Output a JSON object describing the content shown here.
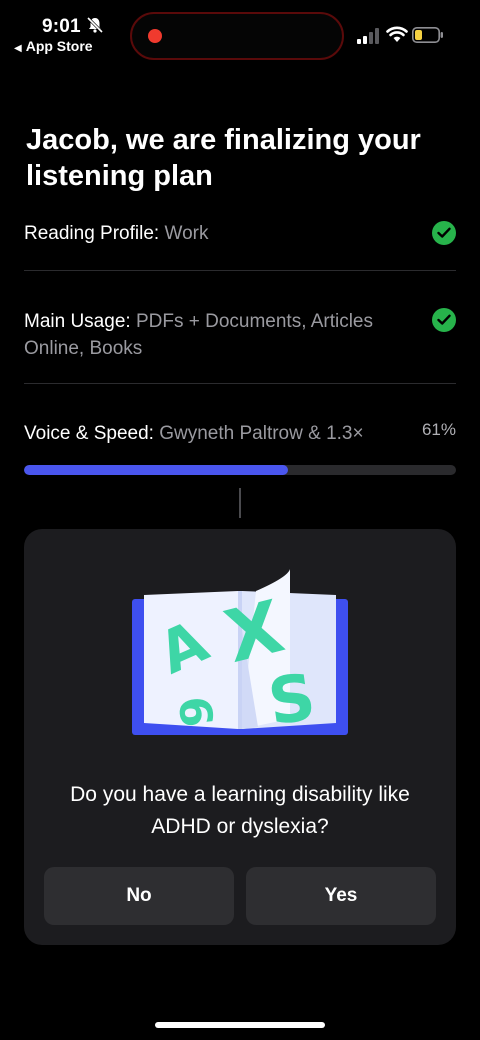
{
  "status_bar": {
    "time": "9:01",
    "back_app": "App Store",
    "icons": [
      "bell-slash-icon",
      "recording-dot-icon",
      "cellular-signal-icon",
      "wifi-icon",
      "battery-low-icon"
    ],
    "colors": {
      "recording": "#f03a2e",
      "battery_level": "#f5d142"
    }
  },
  "title": "Jacob, we are finalizing your listening plan",
  "plan": {
    "items": [
      {
        "label": "Reading Profile:",
        "value": "Work",
        "status": "done"
      },
      {
        "label": "Main Usage:",
        "value": "PDFs + Documents, Articles Online, Books",
        "status": "done"
      },
      {
        "label": "Voice & Speed:",
        "value": "Gwyneth Paltrow & 1.3×",
        "status": "in-progress"
      }
    ],
    "progress_text": "61%",
    "progress": 0.61
  },
  "question_card": {
    "question": "Do you have a learning disability like ADHD or dyslexia?",
    "no_label": "No",
    "yes_label": "Yes",
    "illustration_icon": "book-letters-icon"
  },
  "colors": {
    "background": "#000000",
    "accent": "#4a56ee",
    "check": "#27b34b",
    "card": "#1c1c1f",
    "letters": "#3ed6a6"
  }
}
